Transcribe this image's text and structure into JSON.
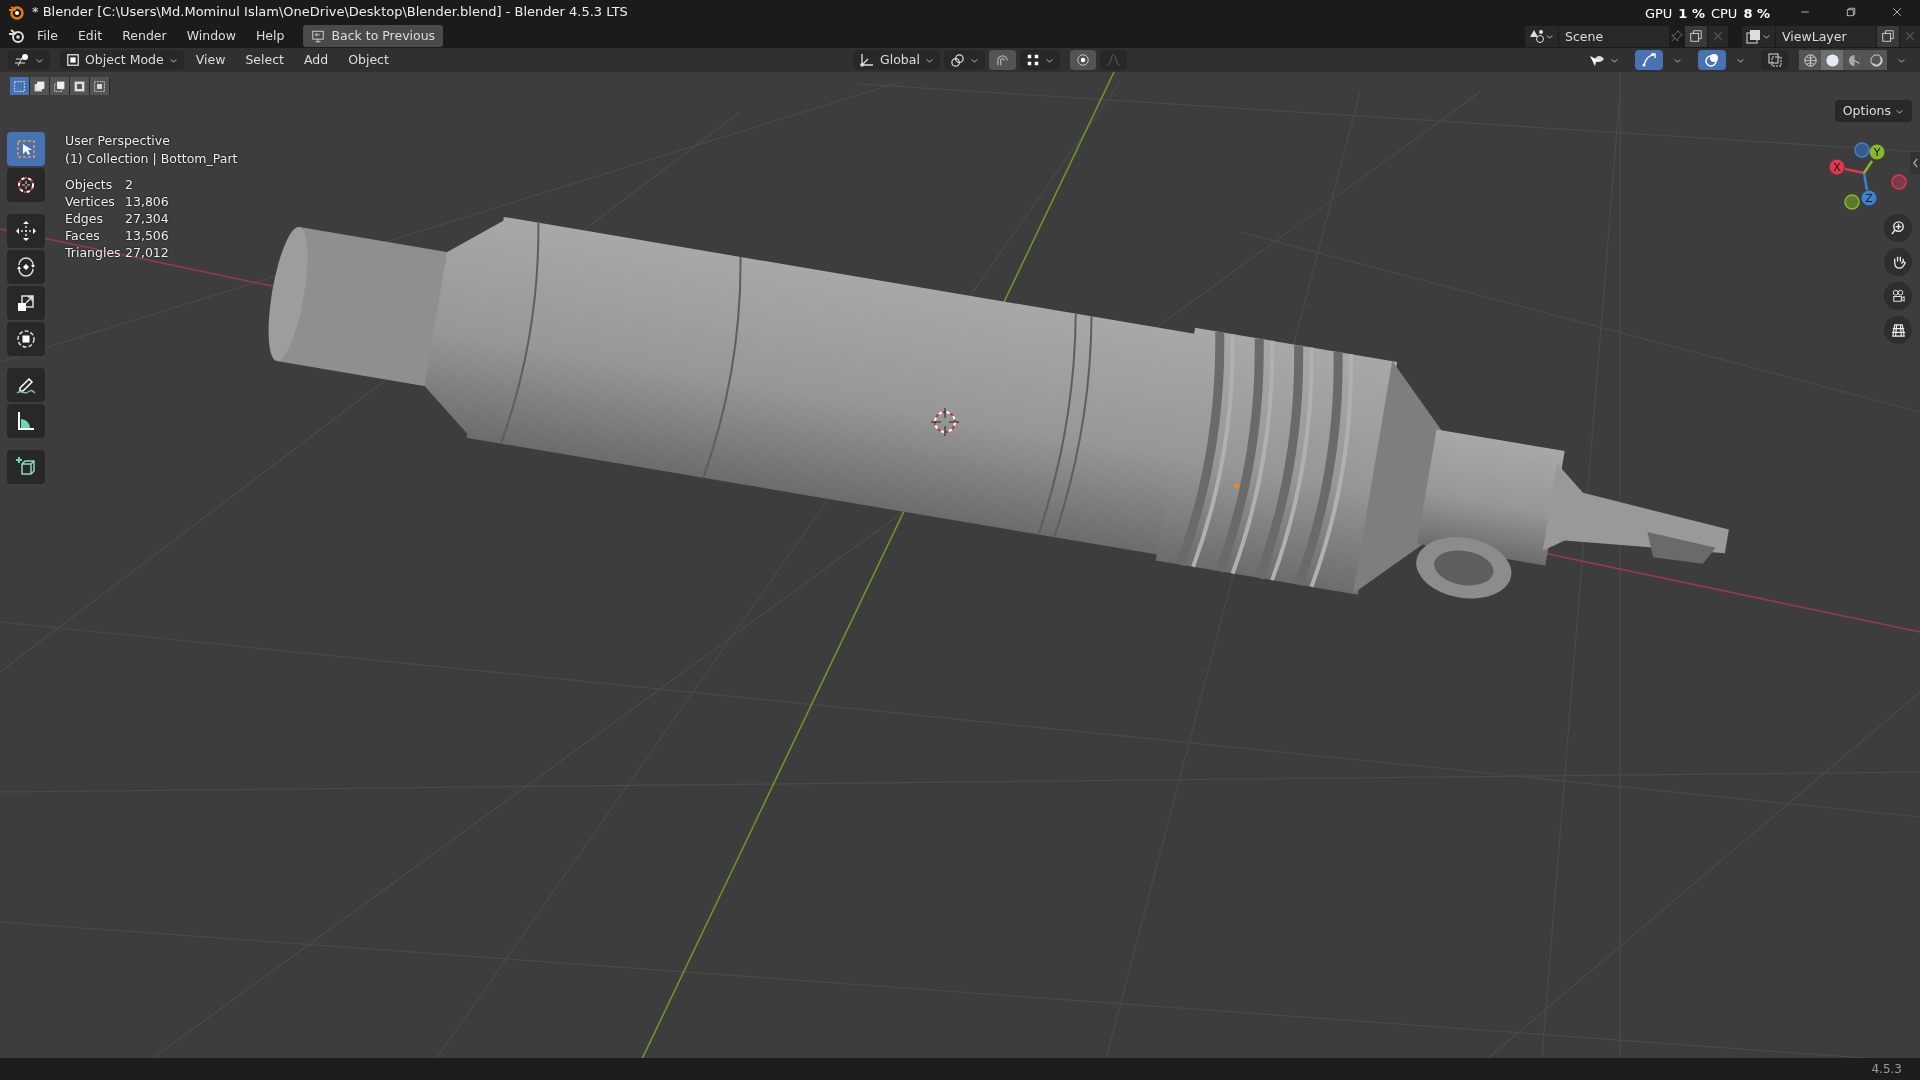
{
  "window": {
    "title": "* Blender [C:\\Users\\Md.Mominul Islam\\OneDrive\\Desktop\\Blender.blend] - Blender 4.5.3 LTS"
  },
  "menu_bar": {
    "items": [
      "File",
      "Edit",
      "Render",
      "Window",
      "Help"
    ],
    "back_button": "Back to Previous"
  },
  "performance": {
    "gpu_label": "GPU",
    "gpu_value": "1 %",
    "cpu_label": "CPU",
    "cpu_value": "8 %"
  },
  "scene": {
    "name": "Scene"
  },
  "view_layer": {
    "name": "ViewLayer"
  },
  "viewport_header": {
    "mode": "Object Mode",
    "menus": [
      "View",
      "Select",
      "Add",
      "Object"
    ],
    "orientation": "Global",
    "toggles": [
      {
        "kind": "gizmos",
        "on": true
      },
      {
        "kind": "overlays",
        "on": true
      },
      {
        "kind": "xray",
        "on": false
      }
    ],
    "shading": [
      {
        "kind": "wireframe",
        "selected": false
      },
      {
        "kind": "solid",
        "selected": true
      },
      {
        "kind": "material",
        "selected": false
      },
      {
        "kind": "rendered",
        "selected": false
      }
    ],
    "options": "Options"
  },
  "select_modes": [
    {
      "kind": "set",
      "selected": true
    },
    {
      "kind": "extend",
      "selected": false
    },
    {
      "kind": "subtract",
      "selected": false
    },
    {
      "kind": "invert",
      "selected": false
    },
    {
      "kind": "intersect",
      "selected": false
    }
  ],
  "tools": [
    {
      "kind": "select",
      "selected": true
    },
    {
      "kind": "cursor",
      "selected": false
    },
    {
      "kind": "move",
      "selected": false
    },
    {
      "kind": "rotate",
      "selected": false
    },
    {
      "kind": "scale",
      "selected": false
    },
    {
      "kind": "transform",
      "selected": false
    },
    {
      "kind": "annotate",
      "selected": false
    },
    {
      "kind": "measure",
      "selected": false
    },
    {
      "kind": "add_cube",
      "selected": false
    }
  ],
  "viewport": {
    "view_name": "User Perspective",
    "context": "(1) Collection | Bottom_Part",
    "stats": [
      {
        "label": "Objects",
        "value": "2"
      },
      {
        "label": "Vertices",
        "value": "13,806"
      },
      {
        "label": "Edges",
        "value": "27,304"
      },
      {
        "label": "Faces",
        "value": "13,506"
      },
      {
        "label": "Triangles",
        "value": "27,012"
      }
    ]
  },
  "gizmo": {
    "axes": [
      {
        "label": "X",
        "color": "#e2364f"
      },
      {
        "label": "Y",
        "color": "#86b92a"
      },
      {
        "label": "Z",
        "color": "#3a82d6"
      }
    ]
  },
  "status_bar": {
    "version": "4.5.3"
  }
}
